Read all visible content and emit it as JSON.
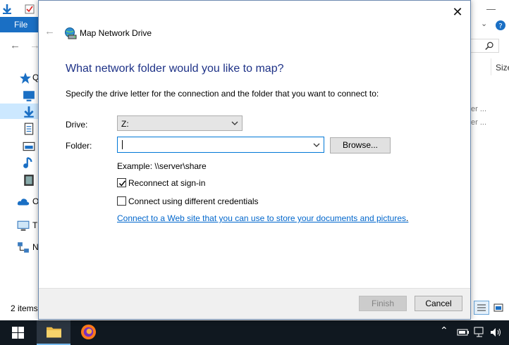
{
  "explorer": {
    "file_tab": "File",
    "sidebar_letters": [
      "Q",
      "O",
      "Th",
      "N"
    ],
    "status_items": "2 items",
    "right_col_header": "Size",
    "right_rows": [
      "er ...",
      "er ..."
    ]
  },
  "dialog": {
    "title": "Map Network Drive",
    "heading": "What network folder would you like to map?",
    "instruction": "Specify the drive letter for the connection and the folder that you want to connect to:",
    "drive_label": "Drive:",
    "drive_value": "Z:",
    "folder_label": "Folder:",
    "folder_value": "",
    "browse_label": "Browse...",
    "example": "Example: \\\\server\\share",
    "reconnect_label": "Reconnect at sign-in",
    "reconnect_checked": true,
    "credentials_label": "Connect using different credentials",
    "credentials_checked": false,
    "web_link": "Connect to a Web site that you can use to store your documents and pictures",
    "web_link_suffix": ".",
    "finish_label": "Finish",
    "cancel_label": "Cancel"
  },
  "colors": {
    "accent": "#0078d7",
    "heading": "#1e3287",
    "link": "#0066cc",
    "taskbar": "#101820"
  }
}
